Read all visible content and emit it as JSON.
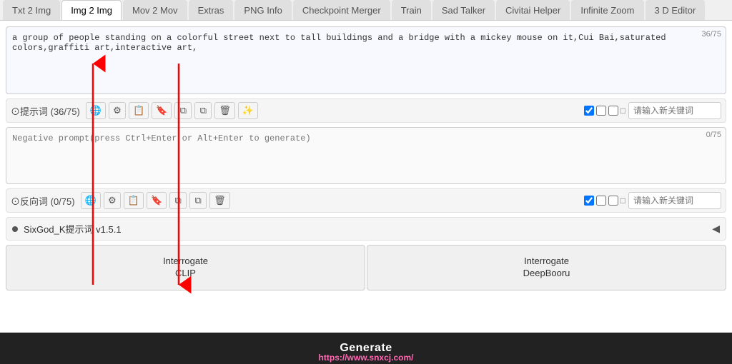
{
  "tabs": [
    {
      "id": "txt2img",
      "label": "Txt 2 Img",
      "active": false
    },
    {
      "id": "img2img",
      "label": "Img 2 Img",
      "active": true
    },
    {
      "id": "mov2mov",
      "label": "Mov 2 Mov",
      "active": false
    },
    {
      "id": "extras",
      "label": "Extras",
      "active": false
    },
    {
      "id": "pnginfo",
      "label": "PNG Info",
      "active": false
    },
    {
      "id": "checkpointmerger",
      "label": "Checkpoint Merger",
      "active": false
    },
    {
      "id": "train",
      "label": "Train",
      "active": false
    },
    {
      "id": "sadtalker",
      "label": "Sad Talker",
      "active": false
    },
    {
      "id": "civitaihelper",
      "label": "Civitai Helper",
      "active": false
    },
    {
      "id": "infinitezoom",
      "label": "Infinite Zoom",
      "active": false
    },
    {
      "id": "3deditor",
      "label": "3 D Editor",
      "active": false
    }
  ],
  "prompt": {
    "counter": "36/75",
    "text": "a group of people standing on a colorful street next to tall buildings and a bridge with a mickey mouse on it,Cui Bai,saturated colors,graffiti art,interactive art,",
    "toolbar_label": "⊙提示词 (36/75)",
    "keyword_placeholder": "请输入新关键词"
  },
  "negative": {
    "counter": "0/75",
    "placeholder": "Negative prompt(press Ctrl+Enter or Alt+Enter to generate)",
    "toolbar_label": "⊙反向词 (0/75)",
    "keyword_placeholder": "请输入新关键词"
  },
  "script": {
    "label": "SixGod_K提示词 v1.5.1"
  },
  "buttons": {
    "interrogate_clip": "Interrogate\nCLIP",
    "interrogate_deepbooru": "Interrogate\nDeepBooru",
    "generate": "Generate"
  },
  "watermark": "https://www.snxcj.com/",
  "icons": {
    "globe": "🌐",
    "settings": "⚙",
    "edit": "📝",
    "bookmark": "🔖",
    "copy1": "⧉",
    "copy2": "⧉",
    "trash": "🗑",
    "magic": "✨",
    "check": "✔",
    "power": "⏻",
    "reload": "↺",
    "square": "□",
    "arrow_right": "◀"
  }
}
